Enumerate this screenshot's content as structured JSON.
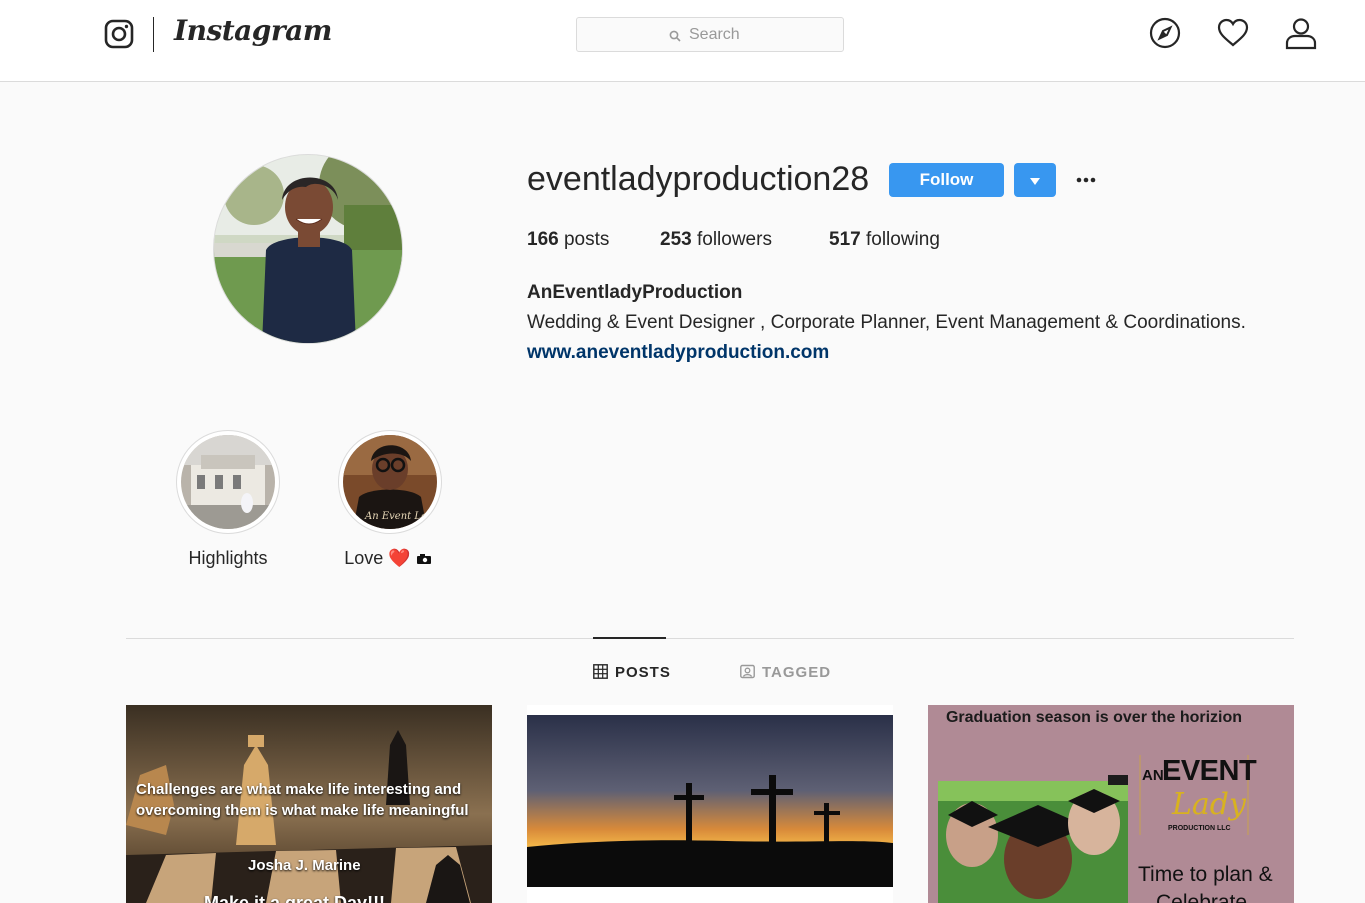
{
  "app": {
    "wordmark": "Instagram"
  },
  "search": {
    "placeholder": "Search"
  },
  "nav": {
    "icons": [
      "compass-icon",
      "heart-icon",
      "user-icon"
    ]
  },
  "profile": {
    "username": "eventladyproduction28",
    "follow_label": "Follow",
    "stats": {
      "posts_count": "166",
      "posts_label": "posts",
      "followers_count": "253",
      "followers_label": "followers",
      "following_count": "517",
      "following_label": "following"
    },
    "full_name": "AnEventladyProduction",
    "bio": "Wedding & Event Designer , Corporate Planner, Event Management & Coordinations.",
    "website": "www.aneventladyproduction.com"
  },
  "highlights": [
    {
      "label": "Highlights"
    },
    {
      "label": "Love",
      "emoji": "❤️"
    }
  ],
  "tabs": [
    {
      "label": "POSTS",
      "active": true
    },
    {
      "label": "TAGGED",
      "active": false
    }
  ],
  "posts": [
    {
      "quote": "Challenges are what make life interesting and overcoming them is what make life meaningful",
      "author": "Josha J. Marine",
      "cut_text": "Make it a great Day!!!"
    },
    {
      "description_visible": false
    },
    {
      "headline": "Graduation season is over the horizion",
      "logo_an": "AN",
      "logo_event": "EVENT",
      "logo_lady": "Lady",
      "logo_production": "PRODUCTION LLC",
      "tagline": "Time to plan &",
      "tagline2": "Celebrate"
    }
  ],
  "colors": {
    "accent": "#3897f0",
    "link": "#003569",
    "border": "#dbdbdb",
    "background": "#fafafa"
  }
}
